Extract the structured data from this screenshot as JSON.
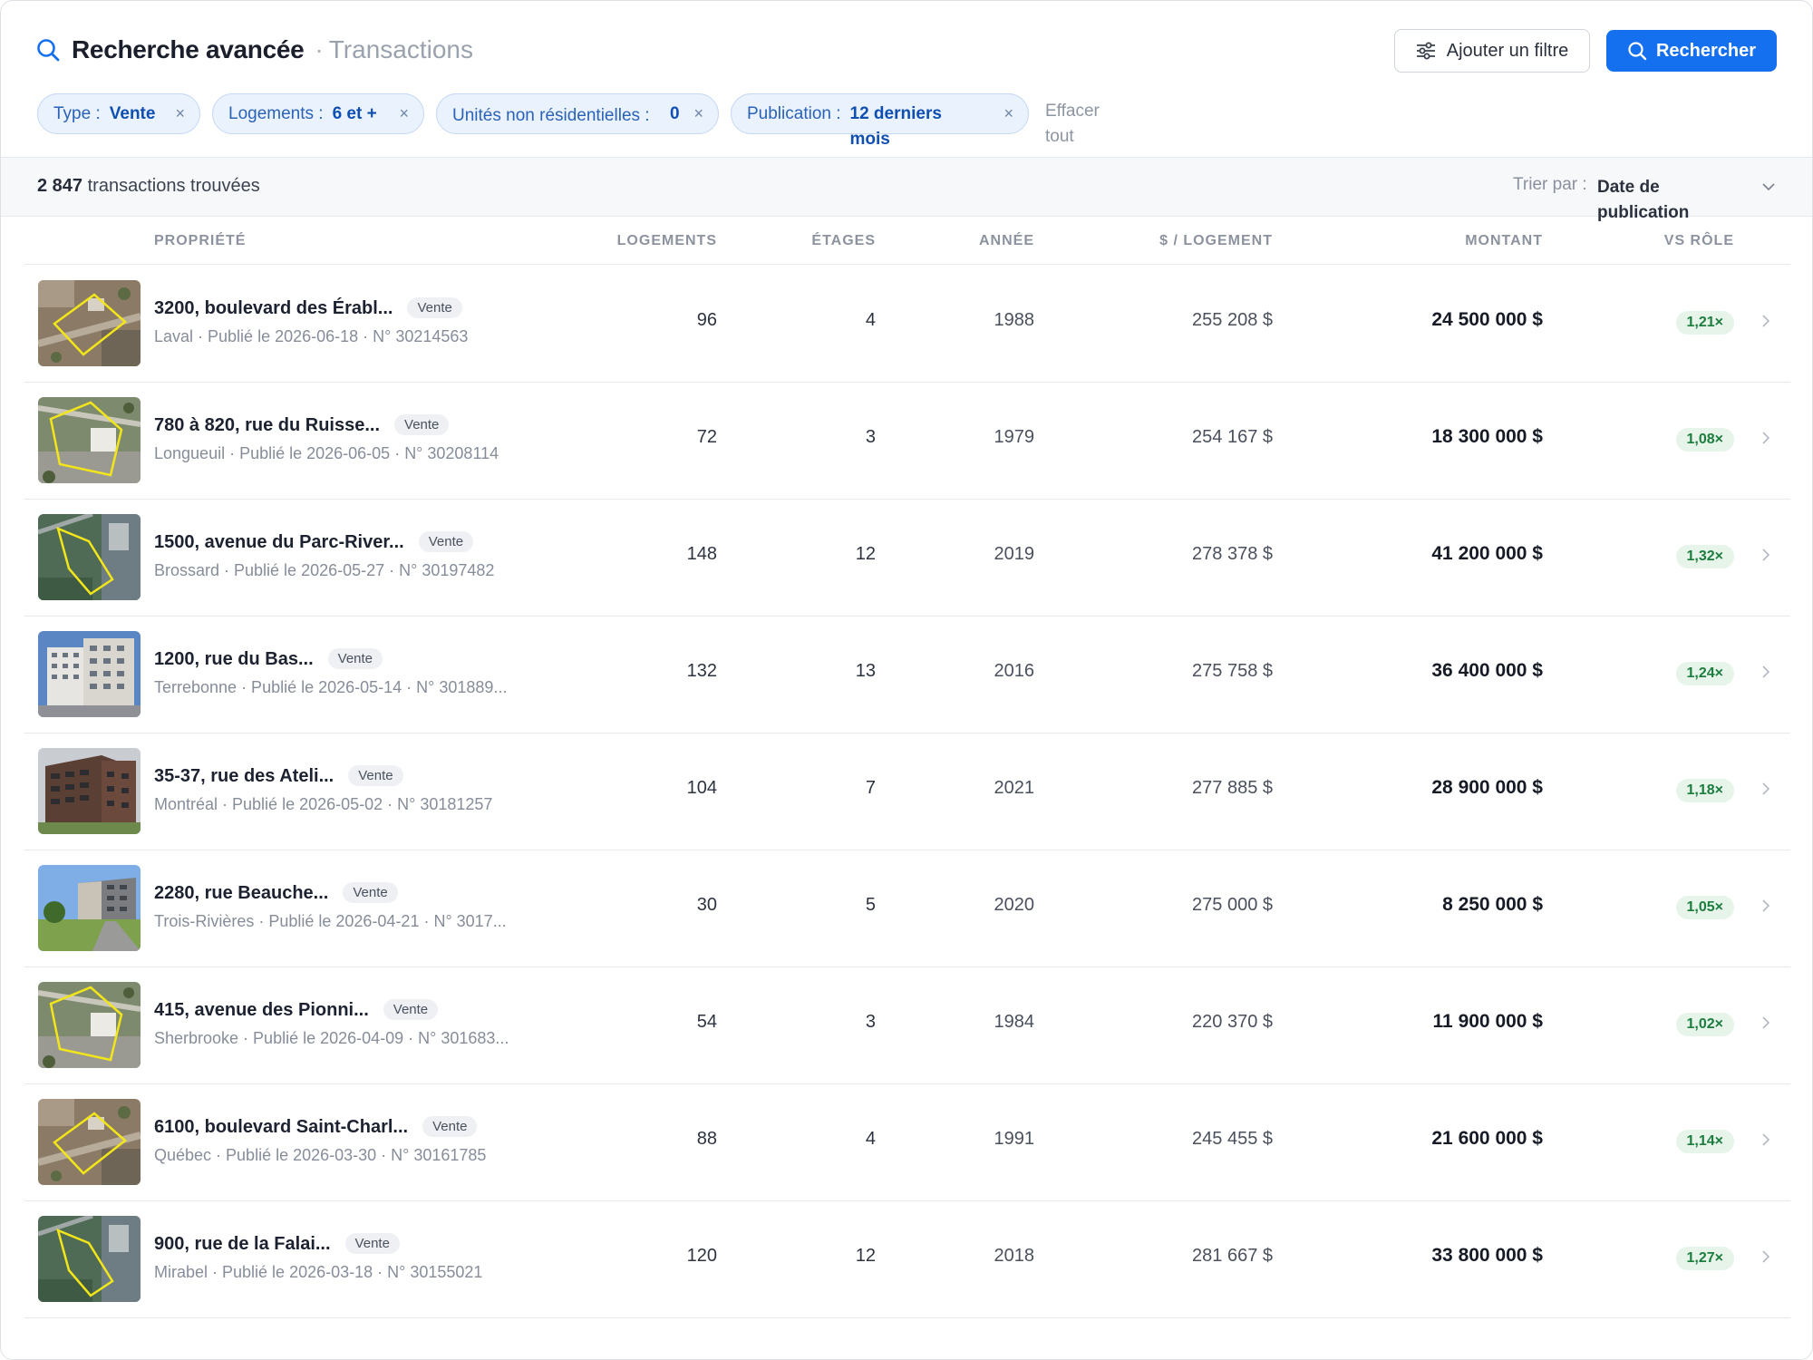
{
  "header": {
    "title": "Recherche avancée",
    "separator": "·",
    "subtitle": "Transactions",
    "add_filter_label": "Ajouter un filtre",
    "search_label": "Rechercher",
    "accent": "#1570ef"
  },
  "filters": {
    "type": {
      "key": "Type :",
      "value": "Vente",
      "remove": "×"
    },
    "logements": {
      "key": "Logements :",
      "value": "6 et +",
      "remove": "×"
    },
    "units": {
      "key": "Unités non résidentielles :",
      "value": "0",
      "remove": "×"
    },
    "publication": {
      "key": "Publication :",
      "value": "12 derniers mois",
      "remove": "×"
    },
    "clear_all": "Effacer tout"
  },
  "results": {
    "count": "2 847",
    "count_suffix": "transactions trouvées",
    "sort_label": "Trier par :",
    "sort_value": "Date de publication"
  },
  "columns": {
    "property": "PROPRIÉTÉ",
    "units": "LOGEMENTS",
    "floors": "ÉTAGES",
    "year": "ANNÉE",
    "per_unit": "$ / LOGEMENT",
    "amount": "MONTANT",
    "vs_role": "VS RÔLE"
  },
  "rows": [
    {
      "address": "3200, boulevard des Érabl...",
      "badge": "Vente",
      "meta": "Laval · Publié le 2026-06-18 · N° 30214563",
      "units": "96",
      "floors": "4",
      "year": "1988",
      "per_unit": "255 208 $",
      "amount": "24 500 000 $",
      "ratio": "1,21×",
      "thumb": "aerial-lot"
    },
    {
      "address": "780 à 820, rue du Ruisse...",
      "badge": "Vente",
      "meta": "Longueuil · Publié le 2026-06-05 · N° 30208114",
      "units": "72",
      "floors": "3",
      "year": "1979",
      "per_unit": "254 167 $",
      "amount": "18 300 000 $",
      "ratio": "1,08×",
      "thumb": "aerial-building"
    },
    {
      "address": "1500, avenue du Parc-River...",
      "badge": "Vente",
      "meta": "Brossard · Publié le 2026-05-27 · N° 30197482",
      "units": "148",
      "floors": "12",
      "year": "2019",
      "per_unit": "278 378 $",
      "amount": "41 200 000 $",
      "ratio": "1,32×",
      "thumb": "aerial-green"
    },
    {
      "address": "1200, rue du Bas...",
      "badge": "Vente",
      "meta": "Terrebonne · Publié le 2026-05-14 · N° 301889...",
      "units": "132",
      "floors": "13",
      "year": "2016",
      "per_unit": "275 758 $",
      "amount": "36 400 000 $",
      "ratio": "1,24×",
      "thumb": "photo-tower"
    },
    {
      "address": "35-37, rue des Ateli...",
      "badge": "Vente",
      "meta": "Montréal · Publié le 2026-05-02 · N° 30181257",
      "units": "104",
      "floors": "7",
      "year": "2021",
      "per_unit": "277 885 $",
      "amount": "28 900 000 $",
      "ratio": "1,18×",
      "thumb": "photo-brick"
    },
    {
      "address": "2280, rue Beauche...",
      "badge": "Vente",
      "meta": "Trois-Rivières · Publié le 2026-04-21 · N° 3017...",
      "units": "30",
      "floors": "5",
      "year": "2020",
      "per_unit": "275 000 $",
      "amount": "8 250 000 $",
      "ratio": "1,05×",
      "thumb": "photo-street"
    },
    {
      "address": "415, avenue des Pionni...",
      "badge": "Vente",
      "meta": "Sherbrooke · Publié le 2026-04-09 · N° 301683...",
      "units": "54",
      "floors": "3",
      "year": "1984",
      "per_unit": "220 370 $",
      "amount": "11 900 000 $",
      "ratio": "1,02×",
      "thumb": "aerial-building"
    },
    {
      "address": "6100, boulevard Saint-Charl...",
      "badge": "Vente",
      "meta": "Québec · Publié le 2026-03-30 · N° 30161785",
      "units": "88",
      "floors": "4",
      "year": "1991",
      "per_unit": "245 455 $",
      "amount": "21 600 000 $",
      "ratio": "1,14×",
      "thumb": "aerial-lot"
    },
    {
      "address": "900, rue de la Falai...",
      "badge": "Vente",
      "meta": "Mirabel · Publié le 2026-03-18 · N° 30155021",
      "units": "120",
      "floors": "12",
      "year": "2018",
      "per_unit": "281 667 $",
      "amount": "33 800 000 $",
      "ratio": "1,27×",
      "thumb": "aerial-green"
    }
  ]
}
